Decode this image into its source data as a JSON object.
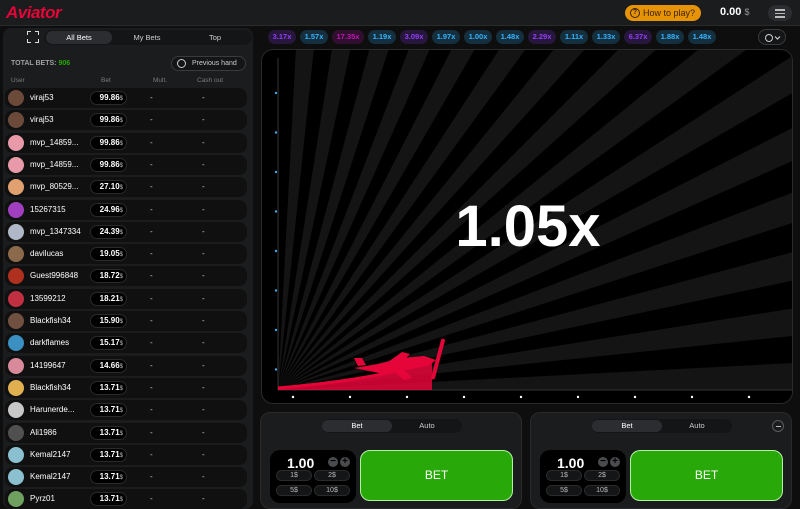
{
  "app": {
    "logo": "Aviator"
  },
  "header": {
    "how_to_play": "How to play?",
    "balance": "0.00",
    "currency": "$"
  },
  "sidebar": {
    "tabs": [
      "All Bets",
      "My Bets",
      "Top"
    ],
    "active_tab": "All Bets",
    "total_label": "TOTAL BETS:",
    "total_count": "906",
    "previous_hand": "Previous hand",
    "columns": {
      "user": "User",
      "bet": "Bet",
      "mult": "Mult.",
      "cashout": "Cash out"
    },
    "bets": [
      {
        "user": "viraj53",
        "bet": "99.86",
        "mult": "-",
        "cashout": "-",
        "avatar": "#6b4a3a"
      },
      {
        "user": "viraj53",
        "bet": "99.86",
        "mult": "-",
        "cashout": "-",
        "avatar": "#6b4a3a"
      },
      {
        "user": "mvp_14859...",
        "bet": "99.86",
        "mult": "-",
        "cashout": "-",
        "avatar": "#e89aa8"
      },
      {
        "user": "mvp_14859...",
        "bet": "99.86",
        "mult": "-",
        "cashout": "-",
        "avatar": "#e89aa8"
      },
      {
        "user": "mvp_80529...",
        "bet": "27.10",
        "mult": "-",
        "cashout": "-",
        "avatar": "#e0a070"
      },
      {
        "user": "15267315",
        "bet": "24.96",
        "mult": "-",
        "cashout": "-",
        "avatar": "#a040c0"
      },
      {
        "user": "mvp_1347334",
        "bet": "24.39",
        "mult": "-",
        "cashout": "-",
        "avatar": "#b0b8c8"
      },
      {
        "user": "davilucas",
        "bet": "19.05",
        "mult": "-",
        "cashout": "-",
        "avatar": "#8a6a4a"
      },
      {
        "user": "Guest996848",
        "bet": "18.72",
        "mult": "-",
        "cashout": "-",
        "avatar": "#b03020"
      },
      {
        "user": "13599212",
        "bet": "18.21",
        "mult": "-",
        "cashout": "-",
        "avatar": "#c03040"
      },
      {
        "user": "Blackfish34",
        "bet": "15.90",
        "mult": "-",
        "cashout": "-",
        "avatar": "#705040"
      },
      {
        "user": "darkflames",
        "bet": "15.17",
        "mult": "-",
        "cashout": "-",
        "avatar": "#3a90c0"
      },
      {
        "user": "14199647",
        "bet": "14.66",
        "mult": "-",
        "cashout": "-",
        "avatar": "#d88a9a"
      },
      {
        "user": "Blackfish34",
        "bet": "13.71",
        "mult": "-",
        "cashout": "-",
        "avatar": "#e0b050"
      },
      {
        "user": "Harunerde...",
        "bet": "13.71",
        "mult": "-",
        "cashout": "-",
        "avatar": "#c8c8c8"
      },
      {
        "user": "Ali1986",
        "bet": "13.71",
        "mult": "-",
        "cashout": "-",
        "avatar": "#505050"
      },
      {
        "user": "Kemal2147",
        "bet": "13.71",
        "mult": "-",
        "cashout": "-",
        "avatar": "#8ac0d0"
      },
      {
        "user": "Kemal2147",
        "bet": "13.71",
        "mult": "-",
        "cashout": "-",
        "avatar": "#8ac0d0"
      },
      {
        "user": "Pyrz01",
        "bet": "13.71",
        "mult": "-",
        "cashout": "-",
        "avatar": "#70a060"
      }
    ]
  },
  "history": {
    "items": [
      {
        "value": "3.17x",
        "color": "#913ef8"
      },
      {
        "value": "1.57x",
        "color": "#34b4ff"
      },
      {
        "value": "17.35x",
        "color": "#c017b4"
      },
      {
        "value": "1.19x",
        "color": "#34b4ff"
      },
      {
        "value": "3.09x",
        "color": "#913ef8"
      },
      {
        "value": "1.97x",
        "color": "#34b4ff"
      },
      {
        "value": "1.00x",
        "color": "#34b4ff"
      },
      {
        "value": "1.48x",
        "color": "#34b4ff"
      },
      {
        "value": "2.29x",
        "color": "#913ef8"
      },
      {
        "value": "1.11x",
        "color": "#34b4ff"
      },
      {
        "value": "1.33x",
        "color": "#34b4ff"
      },
      {
        "value": "6.37x",
        "color": "#913ef8"
      },
      {
        "value": "1.88x",
        "color": "#34b4ff"
      },
      {
        "value": "1.48x",
        "color": "#34b4ff"
      }
    ]
  },
  "game": {
    "multiplier": "1.05x",
    "plane_color": "#e50539"
  },
  "bet_panels": [
    {
      "tabs": [
        "Bet",
        "Auto"
      ],
      "active_tab": "Bet",
      "amount": "1.00",
      "quick": [
        "1$",
        "2$",
        "5$",
        "10$"
      ],
      "button": "BET"
    },
    {
      "tabs": [
        "Bet",
        "Auto"
      ],
      "active_tab": "Bet",
      "amount": "1.00",
      "quick": [
        "1$",
        "2$",
        "5$",
        "10$"
      ],
      "button": "BET"
    }
  ]
}
